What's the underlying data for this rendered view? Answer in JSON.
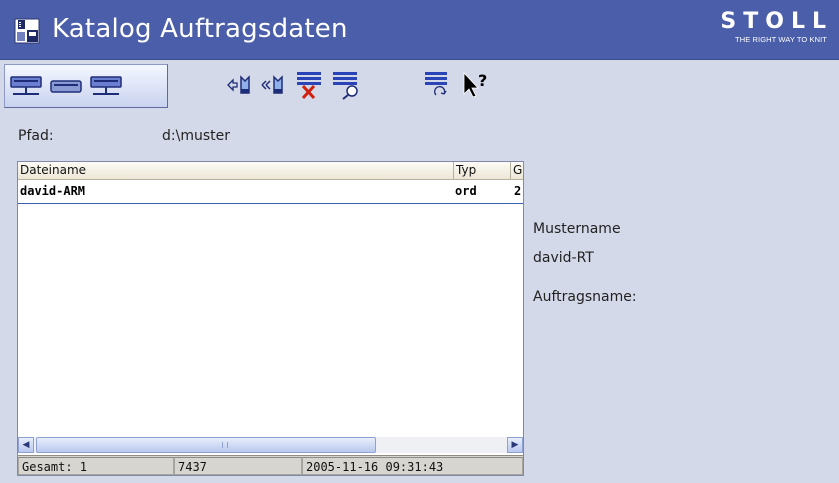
{
  "titlebar": {
    "title": "Katalog Auftragsdaten",
    "icon": "floppy-disk-icon",
    "brand": "STOLL",
    "tagline": "THE RIGHT WAY TO KNIT",
    "bg_color": "#4b5ea9"
  },
  "toolbar": {
    "buttons": [
      {
        "name": "network-drive-icon"
      },
      {
        "name": "local-drive-icon"
      },
      {
        "name": "network-drive-2-icon"
      },
      {
        "name": "copy-pattern-icon"
      },
      {
        "name": "move-pattern-icon"
      },
      {
        "name": "delete-file-icon"
      },
      {
        "name": "search-file-icon"
      },
      {
        "name": "refresh-list-icon"
      },
      {
        "name": "help-cursor-icon"
      }
    ]
  },
  "path": {
    "label": "Pfad:",
    "value": "d:\\muster"
  },
  "filelist": {
    "columns": [
      "Dateiname",
      "Typ",
      "G"
    ],
    "rows": [
      {
        "name": "david-ARM",
        "type": "ord",
        "g": "2"
      }
    ],
    "status": {
      "total": "Gesamt: 1",
      "size": "7437",
      "date": "2005-11-16 09:31:43"
    }
  },
  "info": {
    "pattern_label": "Mustername",
    "pattern_value": "david-RT",
    "order_label": "Auftragsname:"
  }
}
